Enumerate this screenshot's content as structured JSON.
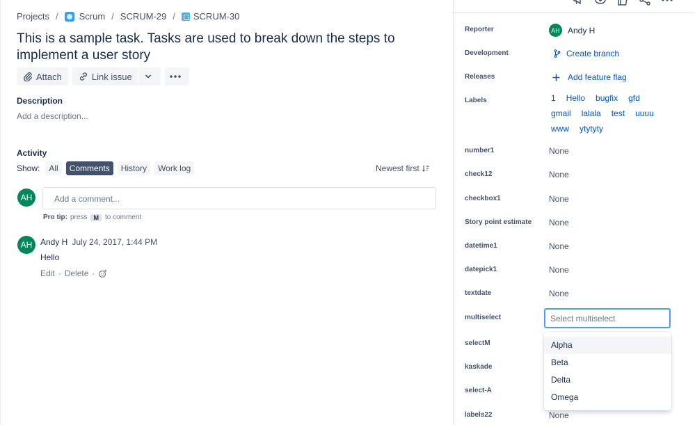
{
  "breadcrumb": {
    "projects": "Projects",
    "project": "Scrum",
    "parent": "SCRUM-29",
    "issue": "SCRUM-30"
  },
  "issue": {
    "title": "This is a sample task. Tasks are used to break down the steps to implement a user story"
  },
  "toolbar": {
    "attach": "Attach",
    "link_issue": "Link issue"
  },
  "description": {
    "heading": "Description",
    "placeholder": "Add a description..."
  },
  "activity": {
    "heading": "Activity",
    "show_label": "Show:",
    "tabs": [
      "All",
      "Comments",
      "History",
      "Work log"
    ],
    "selected_tab": "Comments",
    "sort": "Newest first"
  },
  "comment_box": {
    "avatar": "AH",
    "placeholder": "Add a comment...",
    "protip_label": "Pro tip:",
    "protip_press": "press",
    "protip_key": "M",
    "protip_rest": "to comment"
  },
  "comments": [
    {
      "avatar": "AH",
      "author": "Andy H",
      "time": "July 24, 2017, 1:44 PM",
      "body": "Hello",
      "edit": "Edit",
      "delete": "Delete"
    }
  ],
  "fields": {
    "reporter": {
      "label": "Reporter",
      "value": "Andy H",
      "avatar": "AH"
    },
    "development": {
      "label": "Development",
      "value": "Create branch"
    },
    "releases": {
      "label": "Releases",
      "value": "Add feature flag"
    },
    "labels": {
      "label": "Labels",
      "values": [
        "1",
        "Hello",
        "bugfix",
        "gfd",
        "gmail",
        "lalala",
        "test",
        "uuuu",
        "www",
        "ytytyty"
      ]
    },
    "number1": {
      "label": "number1",
      "value": "None"
    },
    "check12": {
      "label": "check12",
      "value": "None"
    },
    "checkbox1": {
      "label": "checkbox1",
      "value": "None"
    },
    "story_points": {
      "label": "Story point estimate",
      "value": "None"
    },
    "datetime1": {
      "label": "datetime1",
      "value": "None"
    },
    "datepick1": {
      "label": "datepick1",
      "value": "None"
    },
    "textdate": {
      "label": "textdate",
      "value": "None"
    },
    "multiselect": {
      "label": "multiselect",
      "placeholder": "Select multiselect",
      "options": [
        "Alpha",
        "Beta",
        "Delta",
        "Omega"
      ]
    },
    "selectM": {
      "label": "selectM"
    },
    "kaskade": {
      "label": "kaskade"
    },
    "select_a": {
      "label": "select-A"
    },
    "labels22": {
      "label": "labels22",
      "value": "None"
    }
  },
  "colors": {
    "link": "#0052cc",
    "avatar": "#00875a",
    "focus": "#4c9aff",
    "selected_tab": "#42526e"
  }
}
